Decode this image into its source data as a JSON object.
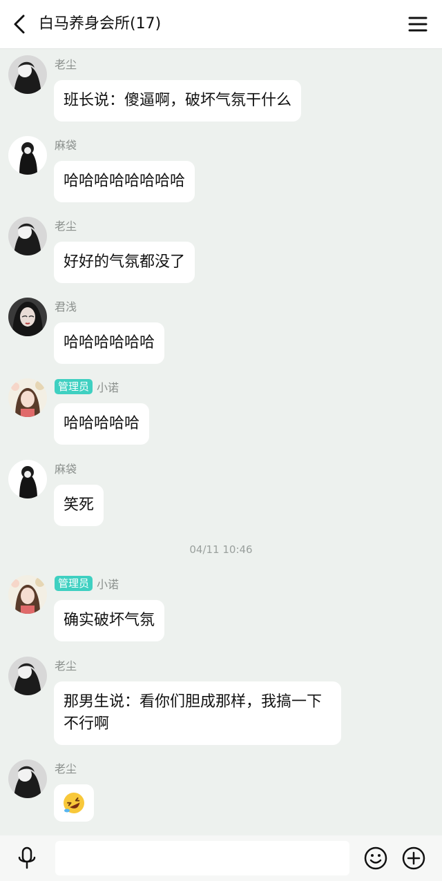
{
  "header": {
    "title": "白马养身会所(17)"
  },
  "messages": [
    {
      "name": "老尘",
      "text": "班长说：傻逼啊，破坏气氛干什么"
    },
    {
      "name": "麻袋",
      "text": "哈哈哈哈哈哈哈哈"
    },
    {
      "name": "老尘",
      "text": "好好的气氛都没了"
    },
    {
      "name": "君浅",
      "text": "哈哈哈哈哈哈"
    },
    {
      "badge": "管理员",
      "name": "小诺",
      "text": "哈哈哈哈哈"
    },
    {
      "name": "麻袋",
      "text": "笑死"
    },
    {
      "badge": "管理员",
      "name": "小诺",
      "text": "确实破坏气氛"
    },
    {
      "name": "老尘",
      "text": "那男生说：看你们胆成那样，我搞一下不行啊"
    },
    {
      "name": "老尘",
      "emoji": "rolling-on-floor-laughing"
    }
  ],
  "timestamp": "04/11 10:46",
  "input": {
    "placeholder": ""
  },
  "icons": [
    "back-arrow-icon",
    "menu-icon",
    "microphone-icon",
    "smiley-icon",
    "plus-icon"
  ]
}
